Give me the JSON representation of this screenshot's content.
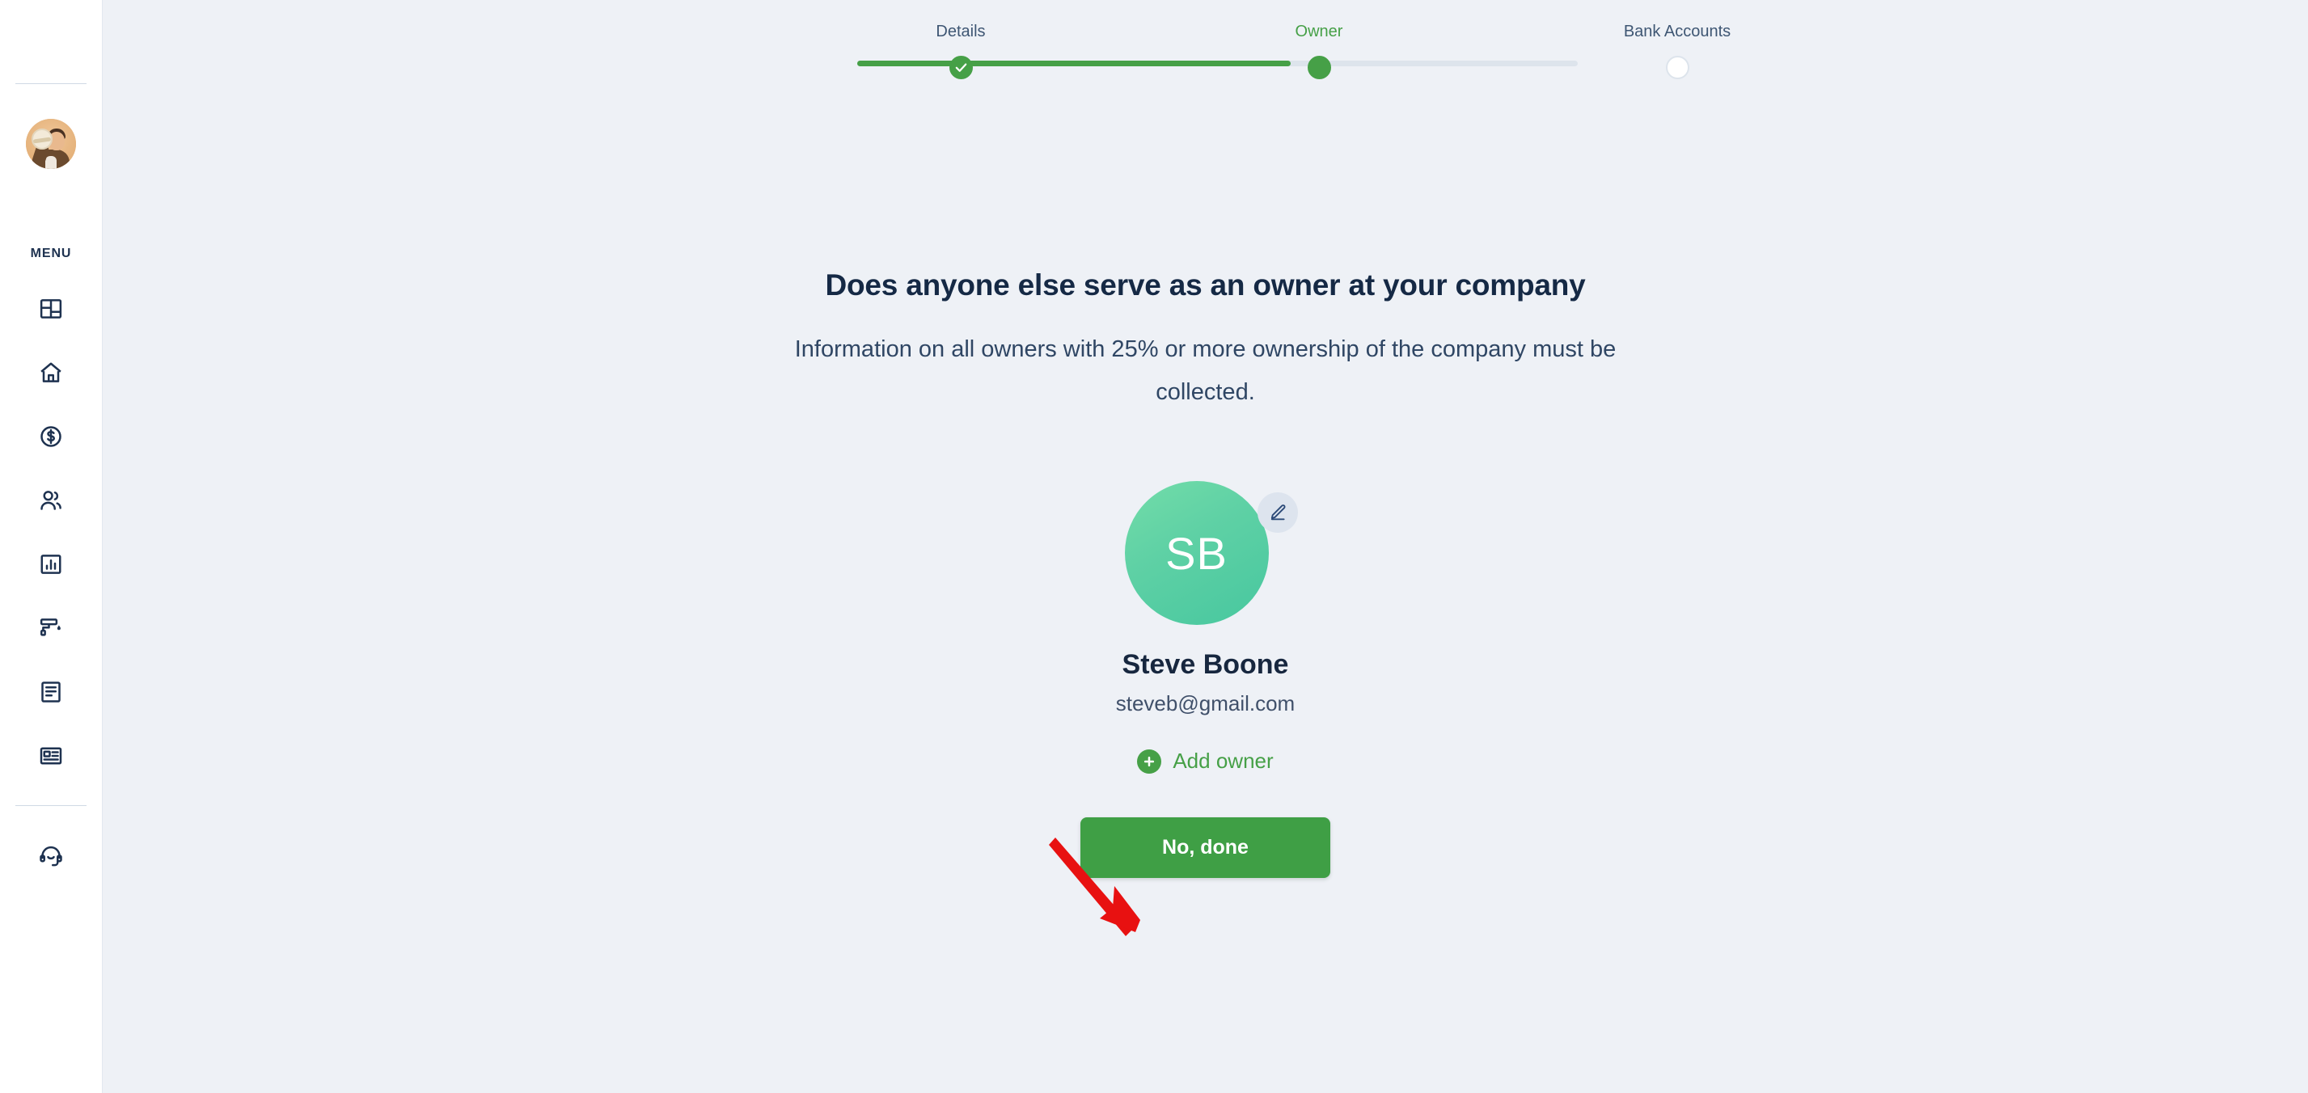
{
  "sidebar": {
    "avatar": {
      "name": "user-profile-photo",
      "alt": "User profile photo"
    },
    "menu_label": "MENU",
    "items": [
      {
        "icon": "dashboard-grid-icon",
        "name": "dashboard"
      },
      {
        "icon": "home-icon",
        "name": "home"
      },
      {
        "icon": "dollar-circle-icon",
        "name": "payments"
      },
      {
        "icon": "people-icon",
        "name": "contacts"
      },
      {
        "icon": "bar-chart-icon",
        "name": "reports"
      },
      {
        "icon": "paint-roller-icon",
        "name": "branding"
      },
      {
        "icon": "document-icon",
        "name": "documents"
      },
      {
        "icon": "news-card-icon",
        "name": "news"
      }
    ],
    "support": {
      "icon": "headset-icon",
      "name": "support"
    }
  },
  "stepper": {
    "steps": [
      {
        "label": "Details",
        "state": "done"
      },
      {
        "label": "Owner",
        "state": "current"
      },
      {
        "label": "Bank Accounts",
        "state": "upcoming"
      }
    ],
    "progress_percent": 60,
    "colors": {
      "complete": "#46a047",
      "track": "#dde4ec",
      "label": "#3e5673",
      "label_current": "#46a047"
    }
  },
  "content": {
    "heading": "Does anyone else serve as an owner at your company",
    "subheading": "Information on all owners with 25% or more ownership of the company must be collected.",
    "owner": {
      "initials": "SB",
      "name": "Steve Boone",
      "email": "steveb@gmail.com",
      "edit_icon": "pencil-icon"
    },
    "add_owner": {
      "label": "Add owner",
      "icon": "plus-circle-icon"
    },
    "primary_button": {
      "label": "No, done",
      "color": "#3f9f45"
    }
  },
  "annotation": {
    "arrow": {
      "name": "red-pointer-arrow",
      "color": "#e81111",
      "points_to": "No, done"
    }
  },
  "colors": {
    "page_background": "#eef1f6",
    "sidebar_background": "#ffffff",
    "icon": "#1e3250",
    "heading": "#152945",
    "accent_green": "#46a047",
    "avatar_green": "#5fd1a5"
  }
}
